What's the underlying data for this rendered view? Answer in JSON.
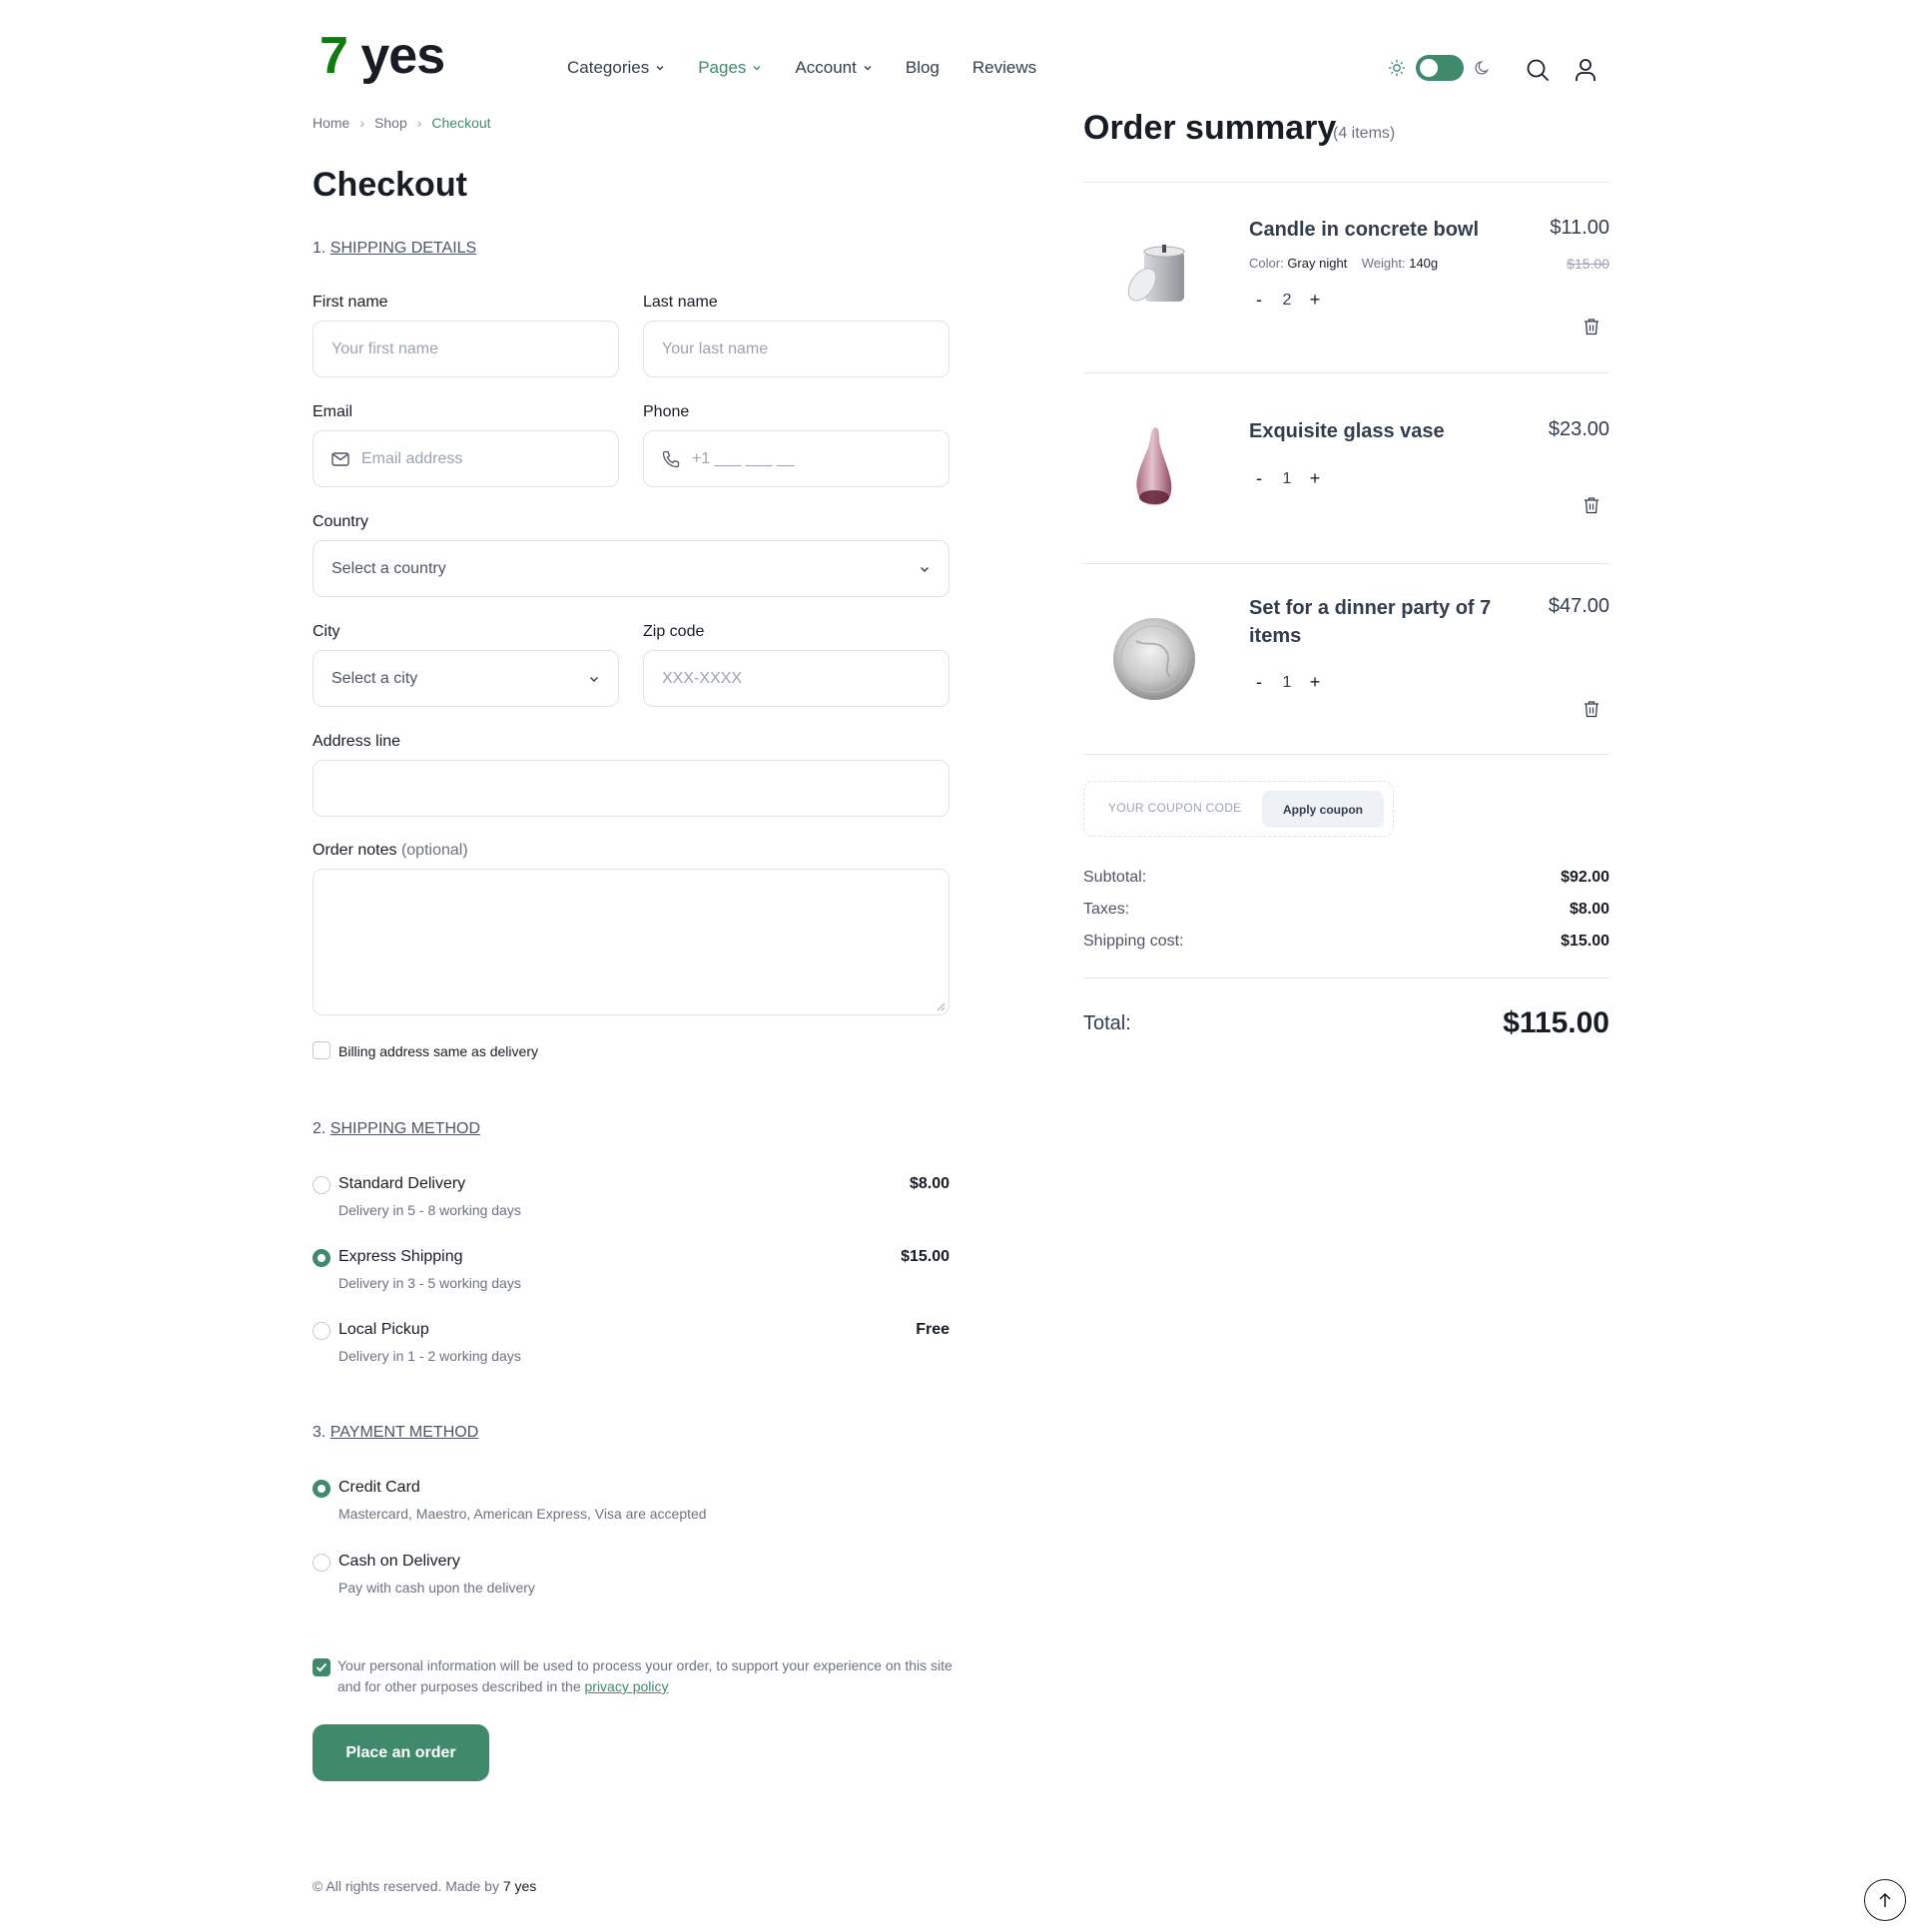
{
  "header": {
    "logo_number": "7",
    "logo_text": "yes",
    "nav": [
      {
        "label": "Categories"
      },
      {
        "label": "Pages"
      },
      {
        "label": "Account"
      },
      {
        "label": "Blog"
      },
      {
        "label": "Reviews"
      }
    ]
  },
  "breadcrumb": {
    "home": "Home",
    "shop": "Shop",
    "current": "Checkout"
  },
  "page_title": "Checkout",
  "shipping_details": {
    "num": "1.",
    "title": "SHIPPING DETAILS",
    "first_name_label": "First name",
    "first_name_placeholder": "Your first name",
    "last_name_label": "Last name",
    "last_name_placeholder": "Your last name",
    "email_label": "Email",
    "email_placeholder": "Email address",
    "phone_label": "Phone",
    "phone_placeholder": "+1 ___ ___ __",
    "country_label": "Country",
    "country_value": "Select a country",
    "city_label": "City",
    "city_value": "Select a city",
    "zip_label": "Zip code",
    "zip_placeholder": "XXX-XXXX",
    "address_label": "Address line",
    "notes_label": "Order notes",
    "notes_optional": "(optional)",
    "billing_same_label": "Billing address same as delivery",
    "billing_same_checked": false
  },
  "shipping_method": {
    "num": "2.",
    "title": "SHIPPING METHOD",
    "selected": "Express Shipping",
    "options": [
      {
        "name": "Standard Delivery",
        "desc": "Delivery in 5 - 8 working days",
        "price": "$8.00"
      },
      {
        "name": "Express Shipping",
        "desc": "Delivery in 3 - 5 working days",
        "price": "$15.00"
      },
      {
        "name": "Local Pickup",
        "desc": "Delivery in 1 - 2 working days",
        "price": "Free"
      }
    ]
  },
  "payment_method": {
    "num": "3.",
    "title": "PAYMENT METHOD",
    "selected": "Credit Card",
    "options": [
      {
        "name": "Credit Card",
        "desc": "Mastercard, Maestro, American Express, Visa are accepted"
      },
      {
        "name": "Cash on Delivery",
        "desc": "Pay with cash upon the delivery"
      }
    ]
  },
  "consent": {
    "text": "Your personal information will be used to process your order, to support your experience on this site and for other purposes described in the",
    "link": "privacy policy",
    "checked": true
  },
  "place_order_label": "Place an order",
  "footer": {
    "text": "© All rights reserved. Made by",
    "brand": "7 yes"
  },
  "order_summary": {
    "title": "Order summary",
    "count": "(4 items)",
    "items": [
      {
        "name": "Candle in concrete bowl",
        "price": "$11.00",
        "old_price": "$15.00",
        "color_label": "Color:",
        "color": "Gray night",
        "weight_label": "Weight:",
        "weight": "140g",
        "qty": "2",
        "minus": "-",
        "plus": "+"
      },
      {
        "name": "Exquisite glass vase",
        "price": "$23.00",
        "qty": "1",
        "minus": "-",
        "plus": "+"
      },
      {
        "name": "Set for a dinner party of 7 items",
        "price": "$47.00",
        "qty": "1",
        "minus": "-",
        "plus": "+"
      }
    ],
    "coupon_placeholder": "YOUR COUPON CODE",
    "coupon_button": "Apply coupon",
    "subtotal_label": "Subtotal:",
    "subtotal": "$92.00",
    "taxes_label": "Taxes:",
    "taxes": "$8.00",
    "shipping_label": "Shipping cost:",
    "shipping": "$15.00",
    "total_label": "Total:",
    "total": "$115.00"
  },
  "colors": {
    "accent": "#3f8a6b",
    "logo_number": "#0f7a0f",
    "text_dark": "#181d25"
  }
}
